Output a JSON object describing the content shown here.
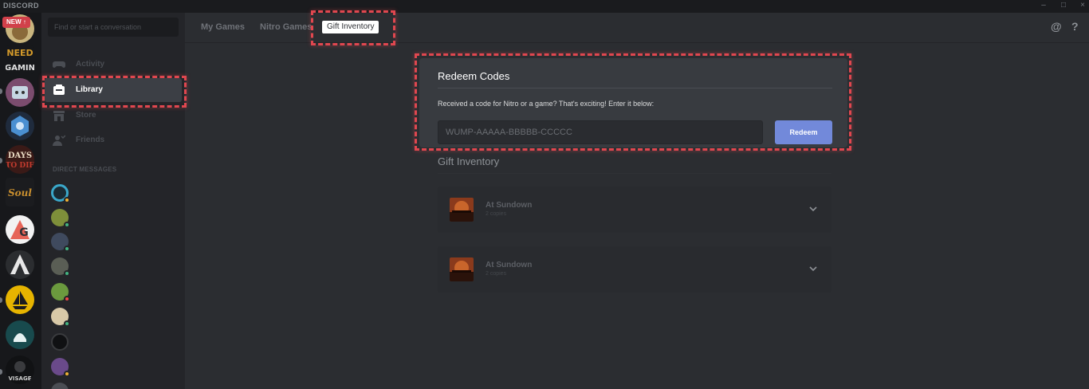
{
  "titlebar": {
    "brand": "DISCORD",
    "minimize": "–",
    "maximize": "□",
    "close": "×"
  },
  "rail": {
    "new_badge": "NEW",
    "guilds": [
      {
        "name": "guild-1",
        "color": "#b9a16a"
      },
      {
        "name": "guild-nerd-gaming",
        "color": "#c48a22"
      },
      {
        "name": "guild-3",
        "color": "#7b4c6e"
      },
      {
        "name": "guild-heroes",
        "color": "#3a6ea8"
      },
      {
        "name": "guild-days-to-die",
        "color": "#7a2b25"
      },
      {
        "name": "guild-6",
        "color": "#8a6a2a"
      },
      {
        "name": "guild-g",
        "color": "#e8e8e8"
      },
      {
        "name": "guild-a",
        "color": "#2f3136"
      },
      {
        "name": "guild-sail",
        "color": "#e6b400"
      },
      {
        "name": "guild-10",
        "color": "#1f5a5a"
      },
      {
        "name": "guild-visage",
        "color": "#1b1c1e"
      }
    ]
  },
  "sidebar": {
    "search_placeholder": "Find or start a conversation",
    "nav": [
      {
        "label": "Activity",
        "icon": "controller-icon"
      },
      {
        "label": "Library",
        "icon": "library-icon"
      },
      {
        "label": "Store",
        "icon": "store-icon"
      },
      {
        "label": "Friends",
        "icon": "friends-icon"
      }
    ],
    "dm_header": "DIRECT MESSAGES",
    "dms": [
      {
        "color": "#3aa7c9",
        "status": "#f0b232"
      },
      {
        "color": "#7e8f3a",
        "status": "#43b581"
      },
      {
        "color": "#3f4a5e",
        "status": "#43b581"
      },
      {
        "color": "#5a5e55",
        "status": "#43b581"
      },
      {
        "color": "#6b9a3e",
        "status": "#f04747"
      },
      {
        "color": "#d8c9a8",
        "status": "#43b581"
      },
      {
        "color": "#2b2d30",
        "status": ""
      },
      {
        "color": "#6a4a8a",
        "status": "#f0b232"
      }
    ]
  },
  "topbar": {
    "tabs": [
      "My Games",
      "Nitro Games",
      "Gift Inventory"
    ],
    "mention_icon": "@",
    "help_icon": "?"
  },
  "redeem": {
    "title": "Redeem Codes",
    "description": "Received a code for Nitro or a game? That's exciting! Enter it below:",
    "placeholder": "WUMP-AAAAA-BBBBB-CCCCC",
    "button": "Redeem"
  },
  "gift_inventory": {
    "title": "Gift Inventory",
    "items": [
      {
        "name": "At Sundown",
        "copies": "2 copies"
      },
      {
        "name": "At Sundown",
        "copies": "2 copies"
      }
    ]
  },
  "colors": {
    "accent": "#7289da",
    "highlight": "#e0474f",
    "online": "#43b581",
    "idle": "#f0b232",
    "dnd": "#f04747"
  }
}
